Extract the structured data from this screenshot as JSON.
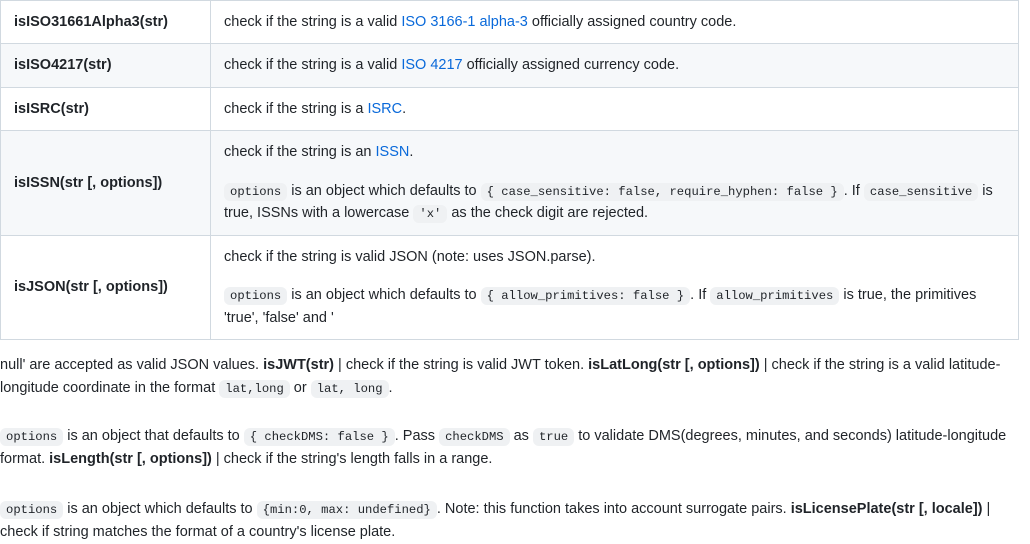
{
  "doc": {
    "table": {
      "rows": [
        {
          "name": "isISO31661Alpha3(str)",
          "desc_lead": "check if the string is a valid ",
          "link_text": "ISO 3166-1 alpha-3",
          "desc_tail": " officially assigned country code."
        },
        {
          "name": "isISO4217(str)",
          "desc_lead": "check if the string is a valid ",
          "link_text": "ISO 4217",
          "desc_tail": " officially assigned currency code."
        },
        {
          "name": "isISRC(str)",
          "desc_lead": "check if the string is a ",
          "link_text": "ISRC",
          "desc_tail": "."
        },
        {
          "name": "isISSN(str [, options])",
          "desc_lead": "check if the string is an ",
          "link_text": "ISSN",
          "desc_tail": ".",
          "p2": {
            "code_options": "options",
            "t1": " is an object which defaults to ",
            "code_default": "{ case_sensitive: false, require_hyphen: false }",
            "t2": ". If ",
            "code_flag": "case_sensitive",
            "t3": " is true, ISSNs with a lowercase ",
            "code_x": "'x'",
            "t4": " as the check digit are rejected."
          }
        },
        {
          "name": "isJSON(str [, options])",
          "desc_plain": "check if the string is valid JSON (note: uses JSON.parse).",
          "p2": {
            "code_options": "options",
            "t1": " is an object which defaults to ",
            "code_default": "{ allow_primitives: false }",
            "t2": ". If ",
            "code_flag": "allow_primitives",
            "t3": " is true, the primitives 'true', 'false' and '"
          }
        }
      ]
    },
    "paragraphs": {
      "p1": {
        "t1": "null' are accepted as valid JSON values. ",
        "fn1": "isJWT(str)",
        "t2": " | check if the string is valid JWT token. ",
        "fn2": "isLatLong(str [, options])",
        "t3": " | check if the string is a valid latitude-longitude coordinate in the format ",
        "code1": "lat,long",
        "t4": " or ",
        "code2": "lat, long",
        "t5": "."
      },
      "p2": {
        "code1": "options",
        "t1": " is an object that defaults to ",
        "code2": "{ checkDMS: false }",
        "t2": ". Pass ",
        "code3": "checkDMS",
        "t3": " as ",
        "code4": "true",
        "t4": " to validate DMS(degrees, minutes, and seconds) latitude-longitude format. ",
        "fn1": "isLength(str [, options])",
        "t5": " | check if the string's length falls in a range."
      },
      "p3": {
        "code1": "options",
        "t1": " is an object which defaults to ",
        "code2": "{min:0, max: undefined}",
        "t2": ". Note: this function takes into account surrogate pairs. ",
        "fn1": "isLicensePlate(str [, locale])",
        "t3": " | check if string matches the format of a country's license plate."
      }
    },
    "colors": {
      "link": "#0969da",
      "row_stripe": "#f6f8fa",
      "border": "#d1d9e0",
      "code_bg": "#eff1f3",
      "text": "#1f2328"
    }
  }
}
